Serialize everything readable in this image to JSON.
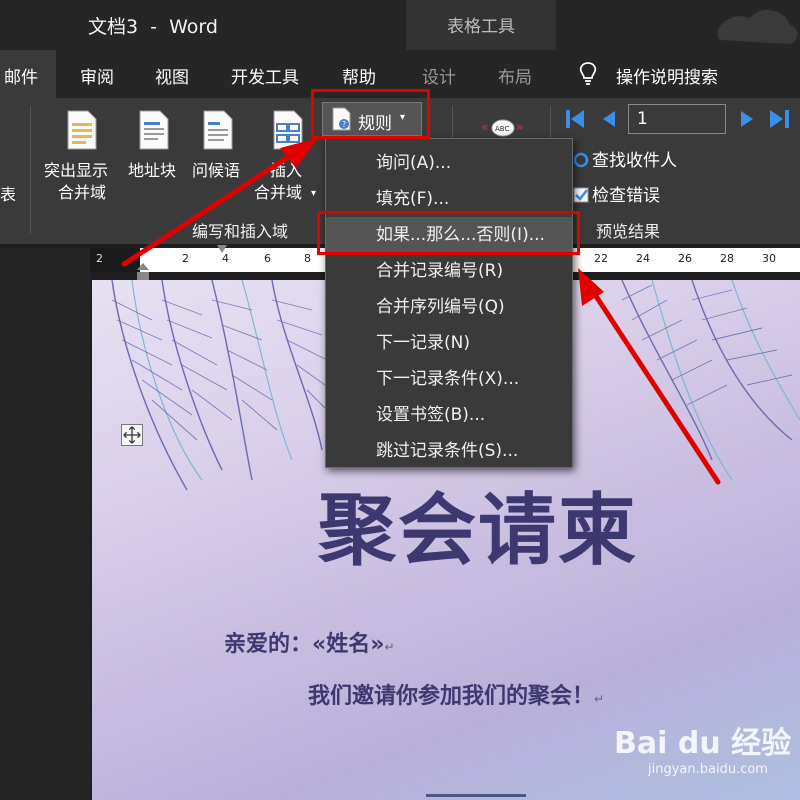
{
  "app": {
    "doc_title": "文档3  -  Word",
    "context_group": "表格工具"
  },
  "tabs": [
    {
      "label": "邮件",
      "active": true
    },
    {
      "label": "审阅"
    },
    {
      "label": "视图"
    },
    {
      "label": "开发工具"
    },
    {
      "label": "帮助"
    },
    {
      "label": "设计",
      "context": true
    },
    {
      "label": "布局",
      "context": true
    },
    {
      "label": "操作说明搜索"
    }
  ],
  "ribbon": {
    "left_cut_label": "表",
    "highlight_merge_fields": [
      "突出显示",
      "合并域"
    ],
    "address_block": "地址块",
    "greeting_line": "问候语",
    "insert_merge_field": [
      "插入",
      "合并域"
    ],
    "group_label": "编写和插入域",
    "rules_label": "规则",
    "record_number": "1",
    "find_recipient": "查找收件人",
    "check_errors": "检查错误",
    "preview_results": "预览结果"
  },
  "ruler": {
    "left_numbers": [
      "2",
      "2",
      "4",
      "6",
      "8"
    ],
    "right_numbers": [
      "22",
      "24",
      "26",
      "28",
      "30"
    ]
  },
  "menu": {
    "items": [
      {
        "label": "询问(A)..."
      },
      {
        "label": "填充(F)..."
      },
      {
        "label": "如果...那么...否则(I)...",
        "highlighted": true
      },
      {
        "label": "合并记录编号(R)"
      },
      {
        "label": "合并序列编号(Q)"
      },
      {
        "label": "下一记录(N)"
      },
      {
        "label": "下一记录条件(X)..."
      },
      {
        "label": "设置书签(B)..."
      },
      {
        "label": "跳过记录条件(S)..."
      }
    ]
  },
  "document": {
    "title": "聚会请柬",
    "greeting": "亲爱的：«姓名»",
    "invite": "我们邀请你参加我们的聚会！"
  },
  "watermark": {
    "logo": "Bai du 经验",
    "url": "jingyan.baidu.com"
  },
  "colors": {
    "annotation_red": "#e00000",
    "doc_text": "#3d3870",
    "ribbon_bg": "#3a3a3a",
    "titlebar_bg": "#262626"
  }
}
